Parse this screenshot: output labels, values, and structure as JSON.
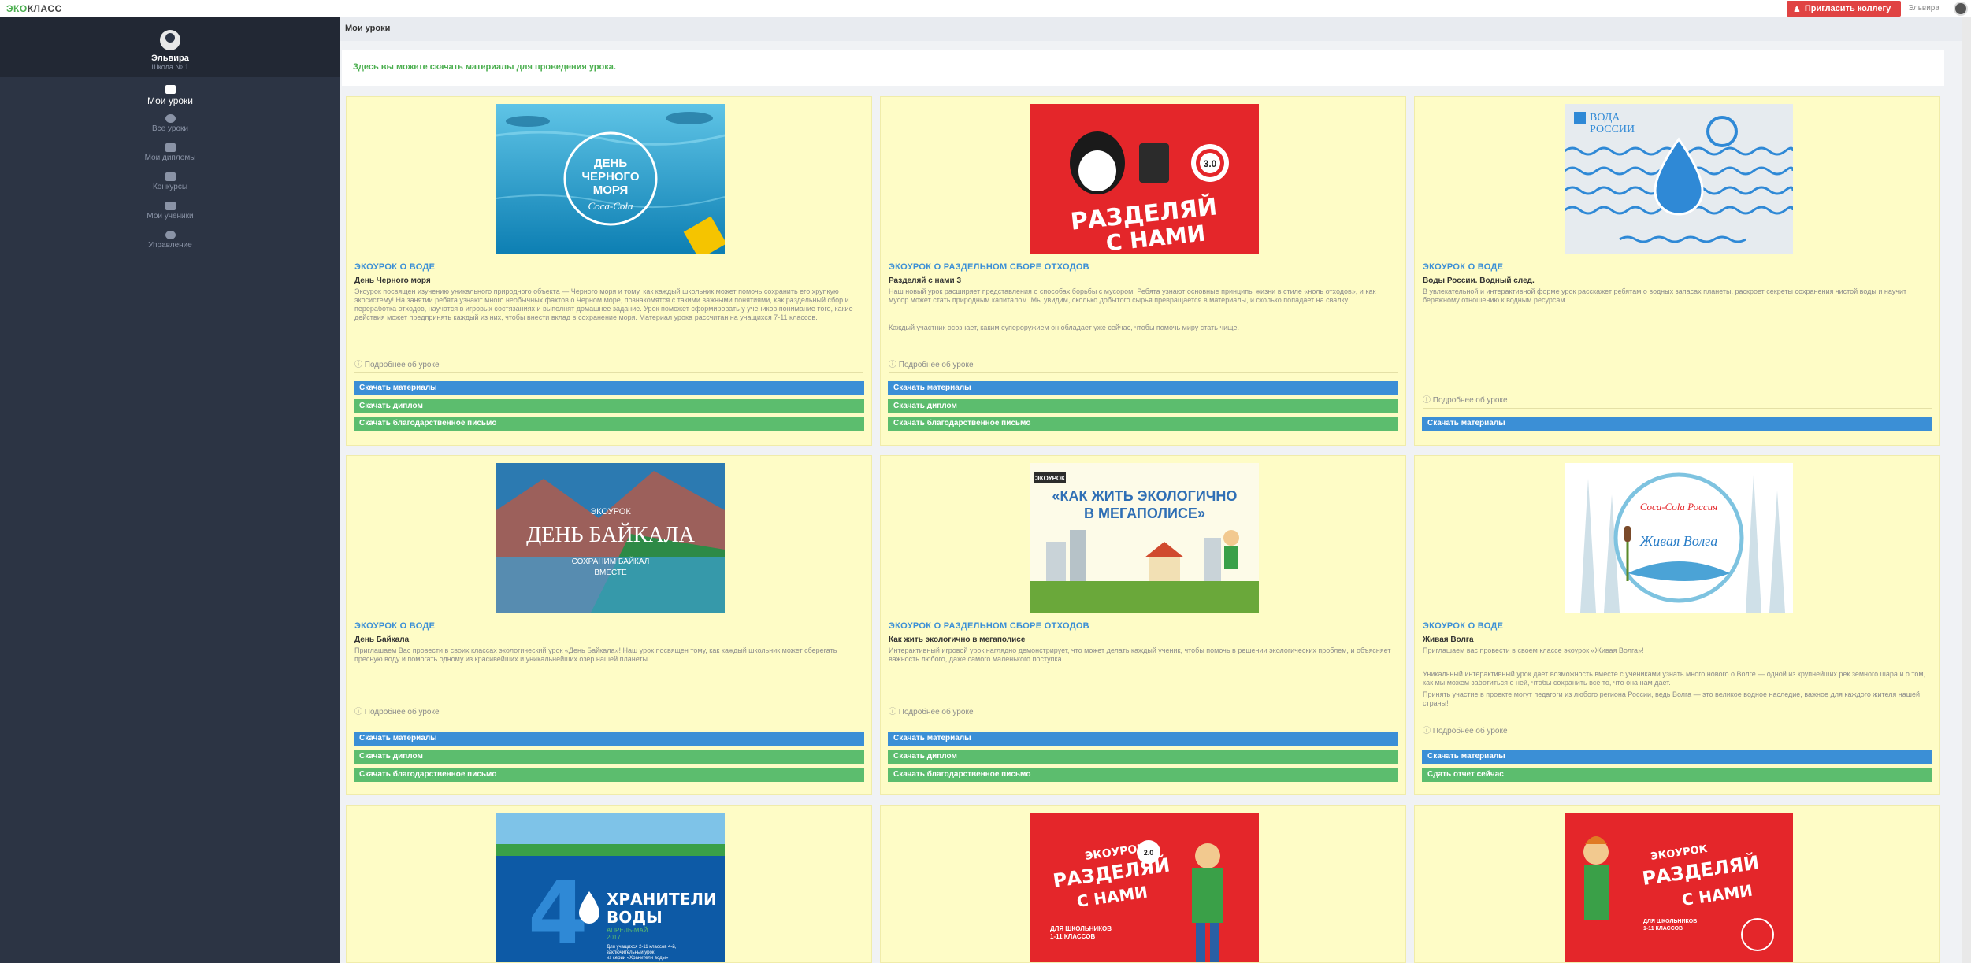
{
  "app": {
    "logo_prefix": "ЭКО",
    "logo_suffix": "КЛАСС"
  },
  "topbar": {
    "invite_label": "Пригласить коллегу",
    "user_name": "Эльвира"
  },
  "sidebar": {
    "profile": {
      "name": "Эльвира",
      "school": "Школа № 1"
    },
    "items": [
      {
        "label": "Мои уроки",
        "icon": "lesson-icon",
        "active": true
      },
      {
        "label": "Все уроки",
        "icon": "globe-icon"
      },
      {
        "label": "Мои дипломы",
        "icon": "trophy-icon"
      },
      {
        "label": "Конкурсы",
        "icon": "medal-icon"
      },
      {
        "label": "Мои ученики",
        "icon": "students-icon"
      },
      {
        "label": "Управление",
        "icon": "gear-icon"
      }
    ]
  },
  "page": {
    "title": "Мои уроки",
    "notice": "Здесь вы можете скачать материалы для проведения урока."
  },
  "more_label": "Подробнее об уроке",
  "buttons": {
    "materials": "Скачать материалы",
    "diploma": "Скачать диплом",
    "letter": "Скачать благодарственное письмо",
    "report": "Сдать отчет сейчас"
  },
  "cards": [
    {
      "category": "ЭКОУРОК О ВОДЕ",
      "title": "День Черного моря",
      "description": "Экоурок посвящен изучению уникального природного объекта — Черного моря и тому, как каждый школьник может помочь сохранить его хрупкую экосистему! На занятии ребята узнают много необычных фактов о Черном море, познакомятся с такими важными понятиями, как раздельный сбор и переработка отходов, научатся в игровых состязаниях и выполнят домашнее задание. Урок поможет сформировать у учеников понимание того, какие действия может предпринять каждый из них, чтобы внести вклад в сохранение моря. Материал урока рассчитан на учащихся 7-11 классов.",
      "image_text": [
        "ДЕНЬ",
        "ЧЕРНОГО",
        "МОРЯ",
        "Coca-Cola"
      ]
    },
    {
      "category": "ЭКОУРОК О РАЗДЕЛЬНОМ СБОРЕ ОТХОДОВ",
      "title": "Разделяй с нами 3",
      "description": "Наш новый урок расширяет представления о способах борьбы с мусором. Ребята узнают основные принципы жизни в стиле «ноль отходов», и как мусор может стать природным капиталом. Мы увидим, сколько добытого сырья превращается в материалы, и сколько попадает на свалку.",
      "description2": "Каждый участник осознает, каким супероружием он обладает уже сейчас, чтобы помочь миру стать чище.",
      "image_text": [
        "РАЗДЕЛЯЙ",
        "С НАМИ",
        "3.0"
      ]
    },
    {
      "category": "ЭКОУРОК О ВОДЕ",
      "title": "Воды России. Водный след.",
      "description": "В увлекательной и интерактивной форме урок расскажет ребятам о водных запасах планеты, раскроет секреты сохранения чистой воды и научит бережному отношению к водным ресурсам.",
      "image_text": [
        "ВОДА",
        "РОССИИ"
      ]
    },
    {
      "category": "ЭКОУРОК О ВОДЕ",
      "title": "День Байкала",
      "description": "Приглашаем Вас провести в своих классах экологический урок «День Байкала»! Наш урок посвящен тому, как каждый школьник может сберегать пресную воду и помогать одному из красивейших и уникальнейших озер нашей планеты.",
      "image_text": [
        "ЭКОУРОК",
        "ДЕНЬ БАЙКАЛА",
        "СОХРАНИМ БАЙКАЛ",
        "ВМЕСТЕ"
      ]
    },
    {
      "category": "ЭКОУРОК О РАЗДЕЛЬНОМ СБОРЕ ОТХОДОВ",
      "title": "Как жить экологично в мегаполисе",
      "description": "Интерактивный игровой урок наглядно демонстрирует, что может делать каждый ученик, чтобы помочь в решении экологических проблем, и объясняет важность любого, даже самого маленького поступка.",
      "image_text": [
        "ЭКОУРОК",
        "«КАК ЖИТЬ ЭКОЛОГИЧНО",
        "В МЕГАПОЛИСЕ»"
      ]
    },
    {
      "category": "ЭКОУРОК О ВОДЕ",
      "title": "Живая Волга",
      "description": "Приглашаем вас провести в своем классе экоурок «Живая Волга»!",
      "description2": "Уникальный интерактивный урок дает возможность вместе с учениками узнать много нового о Волге — одной из крупнейших рек земного шара и о том, как мы можем заботиться о ней, чтобы сохранить все то, что она нам дает.",
      "description3": "Принять участие в проекте могут педагоги из любого региона России, ведь Волга — это великое водное наследие, важное для каждого жителя нашей страны!",
      "image_text": [
        "Coca-Cola Россия",
        "Живая Волга"
      ]
    },
    {
      "image_text": [
        "4",
        "ХРАНИТЕЛИ",
        "ВОДЫ",
        "АПРЕЛЬ-МАЙ",
        "2017",
        "Для учащихся 2-11 классов 4-й,",
        "заключительный урок",
        "из серии «Хранители воды»"
      ]
    },
    {
      "image_text": [
        "ЭКОУРОК",
        "РАЗДЕЛЯЙ",
        "С НАМИ",
        "2.0",
        "ДЛЯ ШКОЛЬНИКОВ",
        "1-11 КЛАССОВ"
      ]
    },
    {
      "image_text": [
        "ЭКОУРОК",
        "РАЗДЕЛЯЙ",
        "С НАМИ",
        "ДЛЯ ШКОЛЬНИКОВ",
        "1-11 КЛАССОВ"
      ]
    }
  ]
}
